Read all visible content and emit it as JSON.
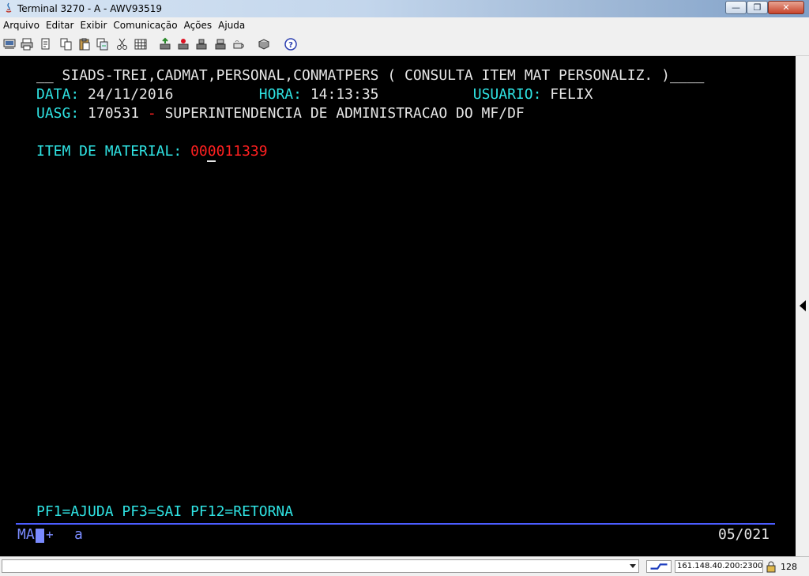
{
  "window": {
    "title": "Terminal 3270 - A - AWV93519",
    "min_label": "—",
    "max_label": "❐",
    "close_label": "✕"
  },
  "menu": [
    "Arquivo",
    "Editar",
    "Exibir",
    "Comunicação",
    "Ações",
    "Ajuda"
  ],
  "toolbar": {
    "icons": [
      "print-screen-icon",
      "print-icon",
      "page-setup-icon",
      "copy-icon",
      "paste-icon",
      "copy-append-icon",
      "cut-icon",
      "keypad-icon",
      "send-file-icon",
      "receive-file-icon",
      "transfer-icon",
      "record-macro-icon",
      "macro-play-icon",
      "help-icon"
    ]
  },
  "terminal": {
    "header_prefix": "__ ",
    "header_command": "SIADS-TREI,CADMAT,PERSONAL,CONMATPERS ( CONSULTA ITEM MAT PERSONALIZ. )",
    "header_suffix": "____",
    "date_label": "DATA:",
    "date_value": "24/11/2016",
    "time_label": "HORA:",
    "time_value": "14:13:35",
    "user_label": "USUARIO:",
    "user_value": "FELIX",
    "uasg_label": "UASG:",
    "uasg_code": "170531",
    "uasg_sep": "-",
    "uasg_name": "SUPERINTENDENCIA DE ADMINISTRACAO DO MF/DF",
    "item_label": "ITEM DE MATERIAL:",
    "item_value": "000011339",
    "function_keys": "PF1=AJUDA PF3=SAI PF12=RETORNA",
    "oia_mode": "MA",
    "oia_plus": "+",
    "oia_a": "a",
    "cursor_position": "05/021"
  },
  "statusbar": {
    "host": "161.148.40.200:23000",
    "encryption": "128"
  },
  "colors": {
    "terminal_bg": "#000000",
    "label_cyan": "#2fe3e3",
    "value_white": "#e6e6e6",
    "input_red": "#ff2020",
    "oia_blue": "#7a8bff"
  }
}
